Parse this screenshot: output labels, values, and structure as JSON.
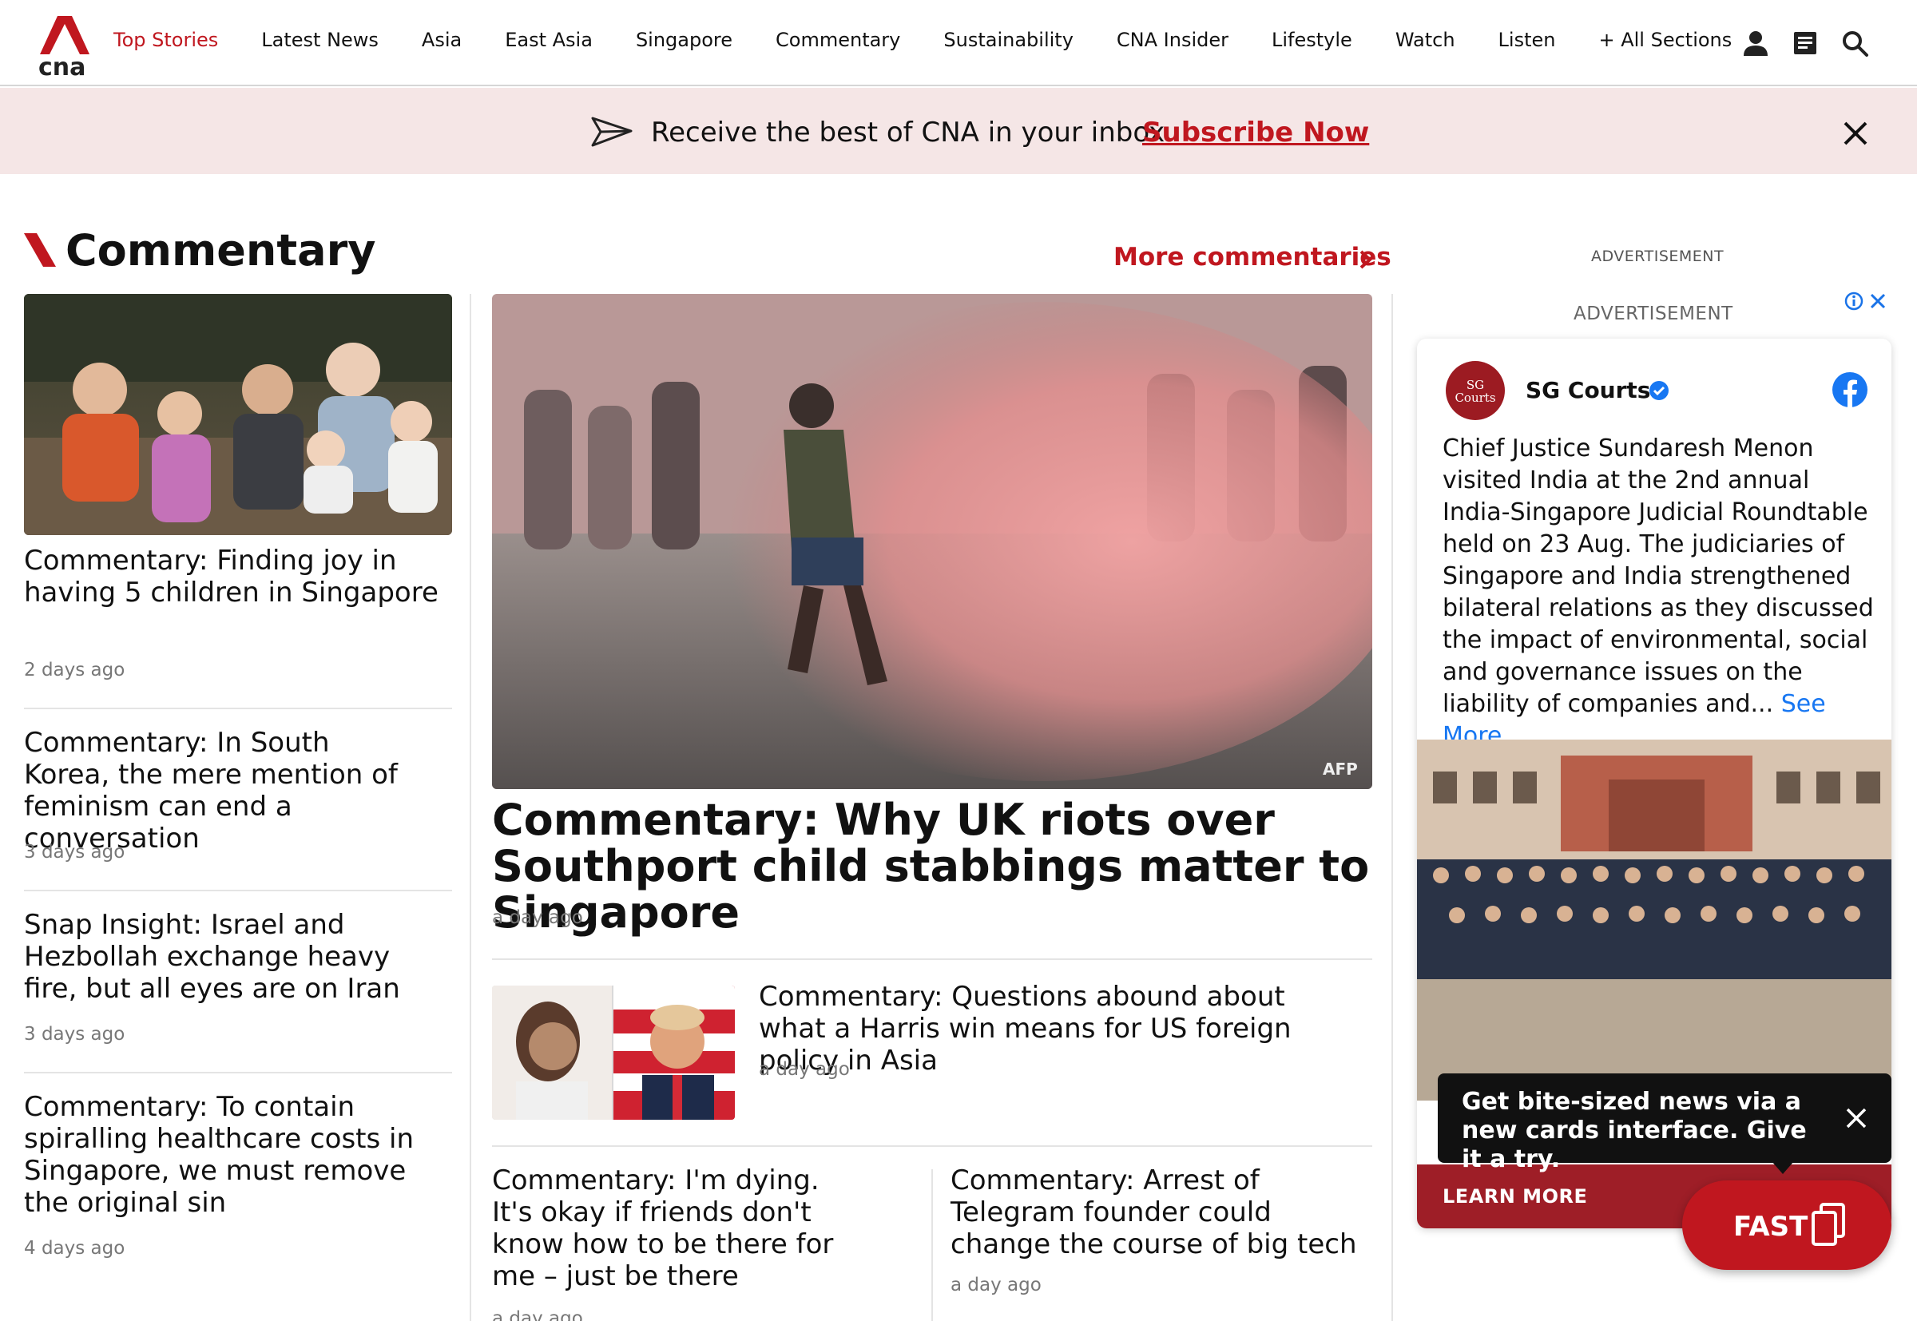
{
  "header": {
    "nav": [
      "Top Stories",
      "Latest News",
      "Asia",
      "East Asia",
      "Singapore",
      "Commentary",
      "Sustainability",
      "CNA Insider",
      "Lifestyle",
      "Watch",
      "Listen",
      "+ All Sections"
    ],
    "logo_text": "cna"
  },
  "banner": {
    "text": "Receive the best of CNA in your inbox",
    "link": "Subscribe Now"
  },
  "section": {
    "title": "Commentary",
    "more": "More commentaries"
  },
  "left_stories": [
    {
      "title": "Commentary: Finding joy in having 5 children in Singapore",
      "time": "2 days ago"
    },
    {
      "title": "Commentary: In South Korea, the mere mention of feminism can end a conversation",
      "time": "3 days ago"
    },
    {
      "title": "Snap Insight: Israel and Hezbollah exchange heavy fire, but all eyes are on Iran",
      "time": "3 days ago"
    },
    {
      "title": "Commentary: To contain spiralling healthcare costs in Singapore, we must remove the original sin",
      "time": "4 days ago"
    }
  ],
  "main_story": {
    "title": "Commentary: Why UK riots over Southport child stabbings matter to Singapore",
    "time": "a day ago",
    "photo_credit": "AFP"
  },
  "mid_story": {
    "title": "Commentary: Questions abound about what a Harris win means for US foreign policy in Asia",
    "time": "a day ago"
  },
  "bottom_stories": [
    {
      "title": "Commentary: I'm dying. It's okay if friends don't know how to be there for me – just be there",
      "time": "a day ago"
    },
    {
      "title": "Commentary: Arrest of Telegram founder could change the course of big tech",
      "time": "a day ago"
    }
  ],
  "ad": {
    "label_top": "ADVERTISEMENT",
    "label_inner": "ADVERTISEMENT",
    "page_name": "SG Courts",
    "avatar_text": "SG Courts",
    "body": "Chief Justice Sundaresh Menon visited India at the 2nd annual India-Singapore Judicial Roundtable held on 23 Aug. The judiciaries of Singapore and India strengthened bilateral relations as they discussed the impact of environmental, social and governance issues on the liability of companies and...",
    "see_more": "See More",
    "cta": "LEARN MORE"
  },
  "fast": {
    "tooltip": "Get bite-sized news via a new cards interface. Give it a try.",
    "button": "FAST"
  },
  "colors": {
    "brand_red": "#c0171f",
    "banner_bg": "#f5e6e6",
    "facebook_blue": "#1877f2"
  }
}
